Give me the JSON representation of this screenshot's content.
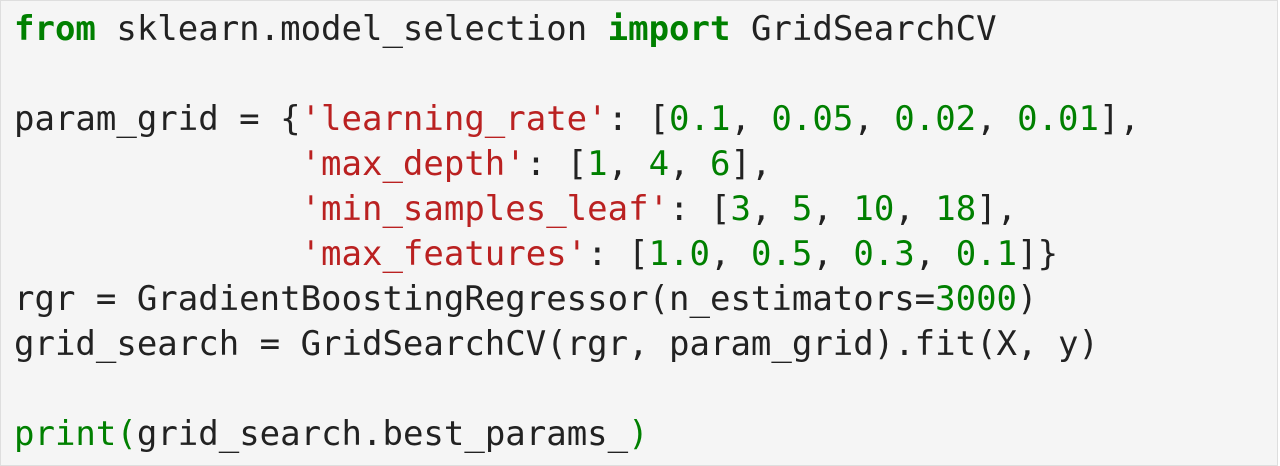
{
  "code_cell": {
    "lines": [
      [
        {
          "t": "from",
          "k": "kw"
        },
        {
          "t": " sklearn.model_selection ",
          "k": "pn"
        },
        {
          "t": "import",
          "k": "kw"
        },
        {
          "t": " GridSearchCV",
          "k": "pn"
        }
      ],
      [],
      [
        {
          "t": "param_grid = {",
          "k": "pn"
        },
        {
          "t": "'learning_rate'",
          "k": "str"
        },
        {
          "t": ": [",
          "k": "pn"
        },
        {
          "t": "0.1",
          "k": "num"
        },
        {
          "t": ", ",
          "k": "pn"
        },
        {
          "t": "0.05",
          "k": "num"
        },
        {
          "t": ", ",
          "k": "pn"
        },
        {
          "t": "0.02",
          "k": "num"
        },
        {
          "t": ", ",
          "k": "pn"
        },
        {
          "t": "0.01",
          "k": "num"
        },
        {
          "t": "],",
          "k": "pn"
        }
      ],
      [
        {
          "t": "              ",
          "k": "pn"
        },
        {
          "t": "'max_depth'",
          "k": "str"
        },
        {
          "t": ": [",
          "k": "pn"
        },
        {
          "t": "1",
          "k": "num"
        },
        {
          "t": ", ",
          "k": "pn"
        },
        {
          "t": "4",
          "k": "num"
        },
        {
          "t": ", ",
          "k": "pn"
        },
        {
          "t": "6",
          "k": "num"
        },
        {
          "t": "],",
          "k": "pn"
        }
      ],
      [
        {
          "t": "              ",
          "k": "pn"
        },
        {
          "t": "'min_samples_leaf'",
          "k": "str"
        },
        {
          "t": ": [",
          "k": "pn"
        },
        {
          "t": "3",
          "k": "num"
        },
        {
          "t": ", ",
          "k": "pn"
        },
        {
          "t": "5",
          "k": "num"
        },
        {
          "t": ", ",
          "k": "pn"
        },
        {
          "t": "10",
          "k": "num"
        },
        {
          "t": ", ",
          "k": "pn"
        },
        {
          "t": "18",
          "k": "num"
        },
        {
          "t": "],",
          "k": "pn"
        }
      ],
      [
        {
          "t": "              ",
          "k": "pn"
        },
        {
          "t": "'max_features'",
          "k": "str"
        },
        {
          "t": ": [",
          "k": "pn"
        },
        {
          "t": "1.0",
          "k": "num"
        },
        {
          "t": ", ",
          "k": "pn"
        },
        {
          "t": "0.5",
          "k": "num"
        },
        {
          "t": ", ",
          "k": "pn"
        },
        {
          "t": "0.3",
          "k": "num"
        },
        {
          "t": ", ",
          "k": "pn"
        },
        {
          "t": "0.1",
          "k": "num"
        },
        {
          "t": "]}",
          "k": "pn"
        }
      ],
      [
        {
          "t": "rgr = GradientBoostingRegressor(n_estimators=",
          "k": "pn"
        },
        {
          "t": "3000",
          "k": "num"
        },
        {
          "t": ")",
          "k": "pn"
        }
      ],
      [
        {
          "t": "grid_search = GridSearchCV(rgr, param_grid).fit(X, y)",
          "k": "pn"
        }
      ],
      [],
      [
        {
          "t": "print",
          "k": "bi"
        },
        {
          "t": "(",
          "k": "bi"
        },
        {
          "t": "grid_search.best_params_",
          "k": "pn"
        },
        {
          "t": ")",
          "k": "bi"
        }
      ]
    ]
  },
  "colors": {
    "background": "#f5f5f5",
    "keyword": "#008000",
    "string": "#ba2121",
    "number": "#008000",
    "text": "#222222"
  }
}
